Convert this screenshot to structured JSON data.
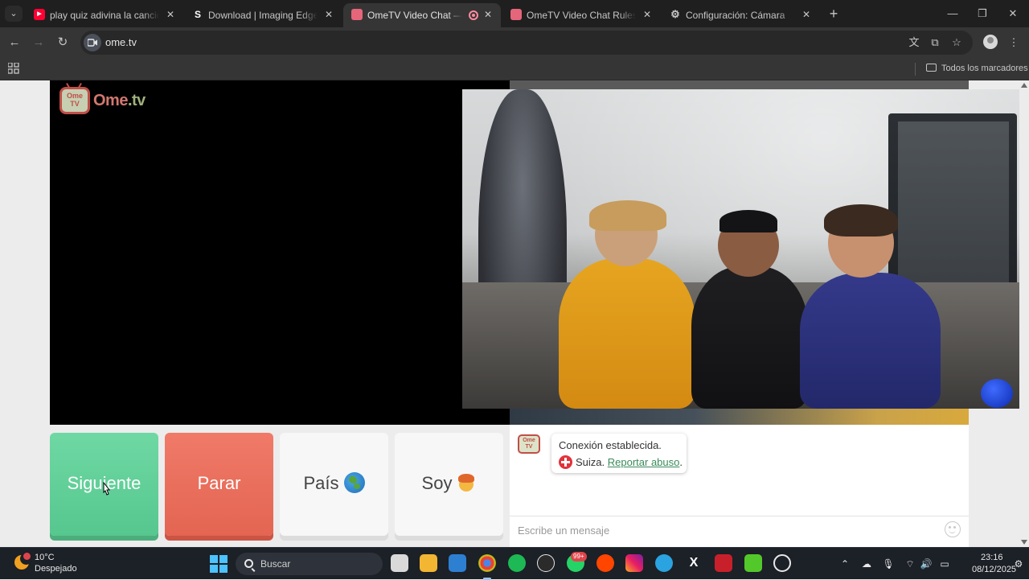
{
  "browser": {
    "tabs": [
      {
        "title": "play quiz adivina la cancion - YouTube",
        "favicon": "youtube-icon",
        "active": false
      },
      {
        "title": "Download | Imaging Edge Webcam",
        "favicon": "s-icon",
        "active": false
      },
      {
        "title": "OmeTV Video Chat — Omegle",
        "favicon": "ometv-icon",
        "active": true,
        "recording": true
      },
      {
        "title": "OmeTV Video Chat Rules and Reg",
        "favicon": "ometv-icon",
        "active": false
      },
      {
        "title": "Configuración: Cámara",
        "favicon": "gear-icon",
        "active": false
      }
    ],
    "url": "ome.tv",
    "bookmarks_folder": "Todos los marcadores"
  },
  "page": {
    "logo_badge": "Ome TV",
    "logo_brand": "Ome",
    "logo_tld": ".tv",
    "buttons": {
      "next": "Siguiente",
      "stop": "Parar",
      "country": "País",
      "me": "Soy"
    },
    "chat": {
      "logo_text": "Ome TV",
      "status": "Conexión establecida.",
      "country": "Suiza.",
      "report_link": "Reportar abuso",
      "period": ".",
      "input_placeholder": "Escribe un mensaje"
    }
  },
  "taskbar": {
    "weather_temp": "10°C",
    "weather_condition": "Despejado",
    "search_placeholder": "Buscar",
    "whatsapp_badge": "99+",
    "time": "23:16",
    "date": "08/12/2025"
  },
  "colors": {
    "next_button": "#5fcf96",
    "stop_button": "#e86c59",
    "browser_chrome": "#353535",
    "link_green": "#3a8a5a"
  }
}
